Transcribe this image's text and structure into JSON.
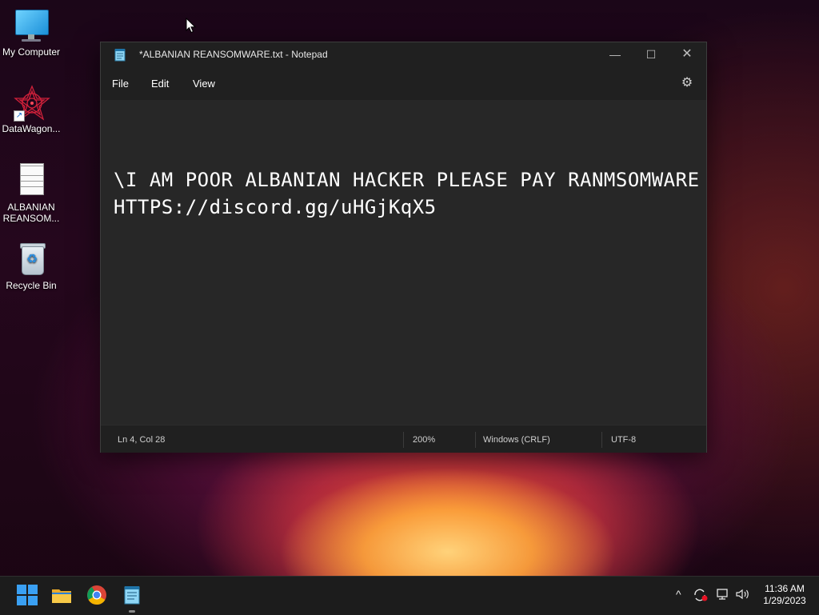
{
  "desktop": {
    "icons": [
      {
        "label": "My Computer"
      },
      {
        "label": "DataWagon..."
      },
      {
        "label_line1": "ALBANIAN",
        "label_line2": "REANSOM..."
      },
      {
        "label": "Recycle Bin"
      }
    ]
  },
  "window": {
    "title": "*ALBANIAN REANSOMWARE.txt - Notepad",
    "controls": {
      "minimize": "—",
      "maximize": "☐",
      "close": "✕"
    },
    "menu": {
      "file": "File",
      "edit": "Edit",
      "view": "View"
    },
    "content": {
      "line1": "\\I AM POOR ALBANIAN HACKER PLEASE PAY RANMSOMWARE",
      "line2": "HTTPS://discord.gg/uHGjKqX5"
    },
    "status": {
      "position": "Ln 4, Col 28",
      "zoom": "200%",
      "line_ending": "Windows (CRLF)",
      "encoding": "UTF-8"
    }
  },
  "taskbar": {
    "apps": [
      "start-icon",
      "file-explorer-icon",
      "chrome-icon",
      "notepad-icon"
    ],
    "tray": {
      "chevron": "^",
      "time": "11:36 AM",
      "date": "1/29/2023"
    }
  },
  "colors": {
    "window_bg": "#272727",
    "titlebar_bg": "#202020",
    "taskbar_bg": "#1c1c1c",
    "start_blue": "#3aa0f3"
  }
}
